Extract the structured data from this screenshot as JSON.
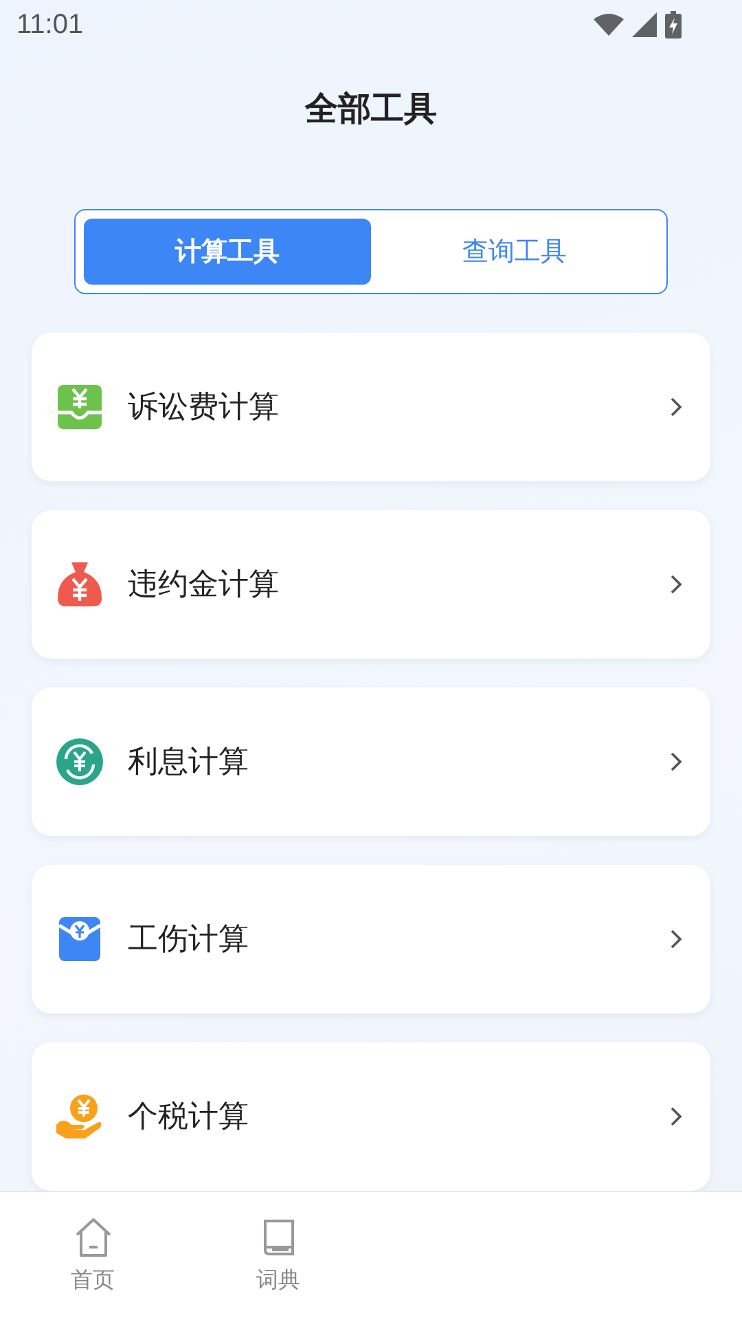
{
  "status_bar": {
    "time": "11:01"
  },
  "title": "全部工具",
  "tabs": [
    {
      "label": "计算工具",
      "selected": true
    },
    {
      "label": "查询工具",
      "selected": false
    }
  ],
  "tools": [
    {
      "label": "诉讼费计算",
      "kind": "tray",
      "color": "#6cc24a"
    },
    {
      "label": "违约金计算",
      "kind": "bag",
      "color": "#ee5b4e"
    },
    {
      "label": "利息计算",
      "kind": "cycle",
      "color": "#2aa58a"
    },
    {
      "label": "工伤计算",
      "kind": "envelope",
      "color": "#3d86f5"
    },
    {
      "label": "个税计算",
      "kind": "hand",
      "color": "#f9a11b"
    }
  ],
  "bottom_nav": [
    {
      "label": "首页",
      "kind": "home"
    },
    {
      "label": "词典",
      "kind": "book"
    }
  ]
}
